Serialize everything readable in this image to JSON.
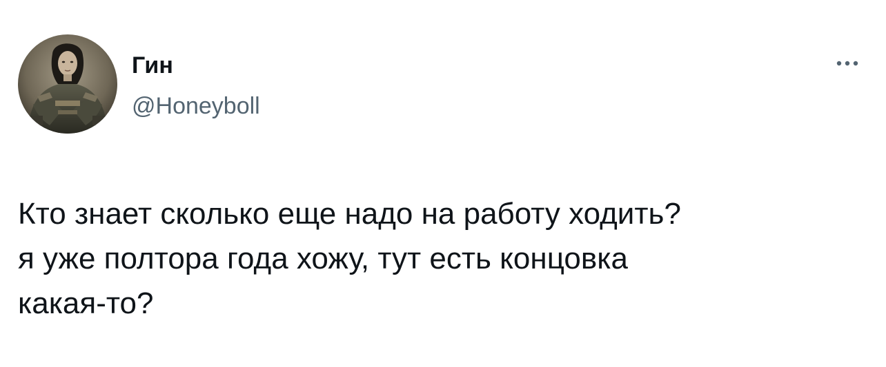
{
  "author": {
    "display_name": "Гин",
    "handle": "@Honeyboll",
    "avatar_icon": "profile-avatar"
  },
  "more_button": {
    "icon": "more-horizontal-icon"
  },
  "tweet": {
    "text": "Кто знает сколько еще надо на работу ходить?\nя уже полтора года хожу, тут есть концовка\nкакая-то?"
  },
  "colors": {
    "text_primary": "#0f1419",
    "text_secondary": "#536471",
    "background": "#ffffff"
  }
}
